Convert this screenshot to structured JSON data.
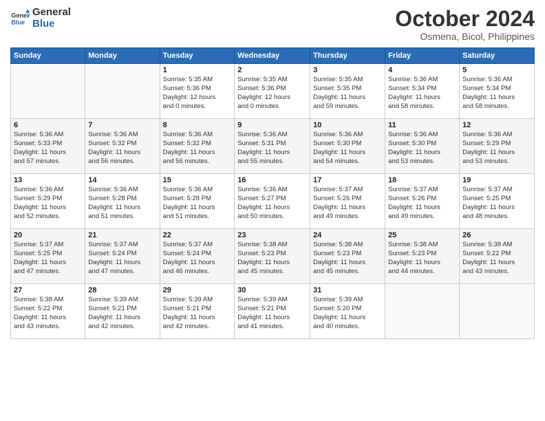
{
  "logo": {
    "line1": "General",
    "line2": "Blue"
  },
  "header": {
    "month": "October 2024",
    "location": "Osmena, Bicol, Philippines"
  },
  "weekdays": [
    "Sunday",
    "Monday",
    "Tuesday",
    "Wednesday",
    "Thursday",
    "Friday",
    "Saturday"
  ],
  "weeks": [
    [
      {
        "day": "",
        "info": ""
      },
      {
        "day": "",
        "info": ""
      },
      {
        "day": "1",
        "info": "Sunrise: 5:35 AM\nSunset: 5:36 PM\nDaylight: 12 hours\nand 0 minutes."
      },
      {
        "day": "2",
        "info": "Sunrise: 5:35 AM\nSunset: 5:36 PM\nDaylight: 12 hours\nand 0 minutes."
      },
      {
        "day": "3",
        "info": "Sunrise: 5:35 AM\nSunset: 5:35 PM\nDaylight: 11 hours\nand 59 minutes."
      },
      {
        "day": "4",
        "info": "Sunrise: 5:36 AM\nSunset: 5:34 PM\nDaylight: 11 hours\nand 58 minutes."
      },
      {
        "day": "5",
        "info": "Sunrise: 5:36 AM\nSunset: 5:34 PM\nDaylight: 11 hours\nand 58 minutes."
      }
    ],
    [
      {
        "day": "6",
        "info": "Sunrise: 5:36 AM\nSunset: 5:33 PM\nDaylight: 11 hours\nand 57 minutes."
      },
      {
        "day": "7",
        "info": "Sunrise: 5:36 AM\nSunset: 5:32 PM\nDaylight: 11 hours\nand 56 minutes."
      },
      {
        "day": "8",
        "info": "Sunrise: 5:36 AM\nSunset: 5:32 PM\nDaylight: 11 hours\nand 56 minutes."
      },
      {
        "day": "9",
        "info": "Sunrise: 5:36 AM\nSunset: 5:31 PM\nDaylight: 11 hours\nand 55 minutes."
      },
      {
        "day": "10",
        "info": "Sunrise: 5:36 AM\nSunset: 5:30 PM\nDaylight: 11 hours\nand 54 minutes."
      },
      {
        "day": "11",
        "info": "Sunrise: 5:36 AM\nSunset: 5:30 PM\nDaylight: 11 hours\nand 53 minutes."
      },
      {
        "day": "12",
        "info": "Sunrise: 5:36 AM\nSunset: 5:29 PM\nDaylight: 11 hours\nand 53 minutes."
      }
    ],
    [
      {
        "day": "13",
        "info": "Sunrise: 5:36 AM\nSunset: 5:29 PM\nDaylight: 11 hours\nand 52 minutes."
      },
      {
        "day": "14",
        "info": "Sunrise: 5:36 AM\nSunset: 5:28 PM\nDaylight: 11 hours\nand 51 minutes."
      },
      {
        "day": "15",
        "info": "Sunrise: 5:36 AM\nSunset: 5:28 PM\nDaylight: 11 hours\nand 51 minutes."
      },
      {
        "day": "16",
        "info": "Sunrise: 5:36 AM\nSunset: 5:27 PM\nDaylight: 11 hours\nand 50 minutes."
      },
      {
        "day": "17",
        "info": "Sunrise: 5:37 AM\nSunset: 5:26 PM\nDaylight: 11 hours\nand 49 minutes."
      },
      {
        "day": "18",
        "info": "Sunrise: 5:37 AM\nSunset: 5:26 PM\nDaylight: 11 hours\nand 49 minutes."
      },
      {
        "day": "19",
        "info": "Sunrise: 5:37 AM\nSunset: 5:25 PM\nDaylight: 11 hours\nand 48 minutes."
      }
    ],
    [
      {
        "day": "20",
        "info": "Sunrise: 5:37 AM\nSunset: 5:25 PM\nDaylight: 11 hours\nand 47 minutes."
      },
      {
        "day": "21",
        "info": "Sunrise: 5:37 AM\nSunset: 5:24 PM\nDaylight: 11 hours\nand 47 minutes."
      },
      {
        "day": "22",
        "info": "Sunrise: 5:37 AM\nSunset: 5:24 PM\nDaylight: 11 hours\nand 46 minutes."
      },
      {
        "day": "23",
        "info": "Sunrise: 5:38 AM\nSunset: 5:23 PM\nDaylight: 11 hours\nand 45 minutes."
      },
      {
        "day": "24",
        "info": "Sunrise: 5:38 AM\nSunset: 5:23 PM\nDaylight: 11 hours\nand 45 minutes."
      },
      {
        "day": "25",
        "info": "Sunrise: 5:38 AM\nSunset: 5:23 PM\nDaylight: 11 hours\nand 44 minutes."
      },
      {
        "day": "26",
        "info": "Sunrise: 5:38 AM\nSunset: 5:22 PM\nDaylight: 11 hours\nand 43 minutes."
      }
    ],
    [
      {
        "day": "27",
        "info": "Sunrise: 5:38 AM\nSunset: 5:22 PM\nDaylight: 11 hours\nand 43 minutes."
      },
      {
        "day": "28",
        "info": "Sunrise: 5:39 AM\nSunset: 5:21 PM\nDaylight: 11 hours\nand 42 minutes."
      },
      {
        "day": "29",
        "info": "Sunrise: 5:39 AM\nSunset: 5:21 PM\nDaylight: 11 hours\nand 42 minutes."
      },
      {
        "day": "30",
        "info": "Sunrise: 5:39 AM\nSunset: 5:21 PM\nDaylight: 11 hours\nand 41 minutes."
      },
      {
        "day": "31",
        "info": "Sunrise: 5:39 AM\nSunset: 5:20 PM\nDaylight: 11 hours\nand 40 minutes."
      },
      {
        "day": "",
        "info": ""
      },
      {
        "day": "",
        "info": ""
      }
    ]
  ]
}
